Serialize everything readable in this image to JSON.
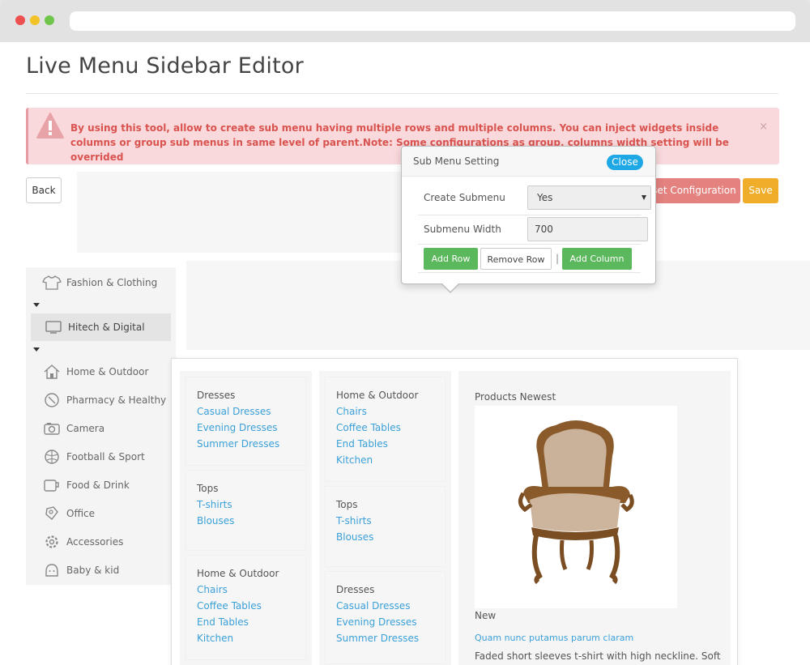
{
  "page": {
    "title": "Live Menu Sidebar Editor"
  },
  "alert": {
    "message": "By using this tool, allow to create sub menu having multiple rows and multiple columns. You can inject widgets inside columns or group sub menus in same level of parent.Note: Some configurations as group, columns width setting will be overrided",
    "close": "×"
  },
  "toolbar": {
    "back": "Back",
    "reset": "Reset Configuration",
    "save": "Save"
  },
  "sidebar": {
    "items": [
      {
        "label": "Fashion & Clothing",
        "icon": "shirt-icon"
      },
      {
        "label": "Hitech & Digital",
        "icon": "monitor-icon"
      },
      {
        "label": "Home & Outdoor",
        "icon": "house-icon"
      },
      {
        "label": "Pharmacy & Healthy",
        "icon": "pharmacy-icon"
      },
      {
        "label": "Camera",
        "icon": "camera-icon"
      },
      {
        "label": "Football & Sport",
        "icon": "ball-icon"
      },
      {
        "label": "Food & Drink",
        "icon": "cup-icon"
      },
      {
        "label": "Office",
        "icon": "office-icon"
      },
      {
        "label": "Accessories",
        "icon": "gear-icon"
      },
      {
        "label": "Baby & kid",
        "icon": "baby-icon"
      }
    ]
  },
  "megamenu": {
    "col1": [
      {
        "heading": "Dresses",
        "links": [
          "Casual Dresses",
          "Evening Dresses",
          "Summer Dresses"
        ]
      },
      {
        "heading": "Tops",
        "links": [
          "T-shirts",
          "Blouses"
        ]
      },
      {
        "heading": "Home & Outdoor",
        "links": [
          "Chairs",
          "Coffee Tables",
          "End Tables",
          "Kitchen"
        ]
      }
    ],
    "col2": [
      {
        "heading": "Home & Outdoor",
        "links": [
          "Chairs",
          "Coffee Tables",
          "End Tables",
          "Kitchen"
        ]
      },
      {
        "heading": "Tops",
        "links": [
          "T-shirts",
          "Blouses"
        ]
      },
      {
        "heading": "Dresses",
        "links": [
          "Casual Dresses",
          "Evening Dresses",
          "Summer Dresses"
        ]
      }
    ],
    "product": {
      "heading": "Products Newest",
      "badge": "New",
      "name": "Quam nunc putamus parum claram",
      "description": "Faded short sleeves t-shirt with high neckline. Soft"
    }
  },
  "popup": {
    "title": "Sub Menu Setting",
    "close": "Close",
    "create_submenu_label": "Create Submenu",
    "create_submenu_value": "Yes",
    "width_label": "Submenu Width",
    "width_value": "700",
    "add_row": "Add Row",
    "remove_row": "Remove Row",
    "separator": "|",
    "add_column": "Add Column"
  },
  "colors": {
    "alert_bg": "#f9d9dc",
    "alert_text": "#d9534f",
    "link": "#3ba0d8",
    "save": "#f0ad2a",
    "green": "#5cb85c",
    "close_pill": "#1ea8e6"
  }
}
